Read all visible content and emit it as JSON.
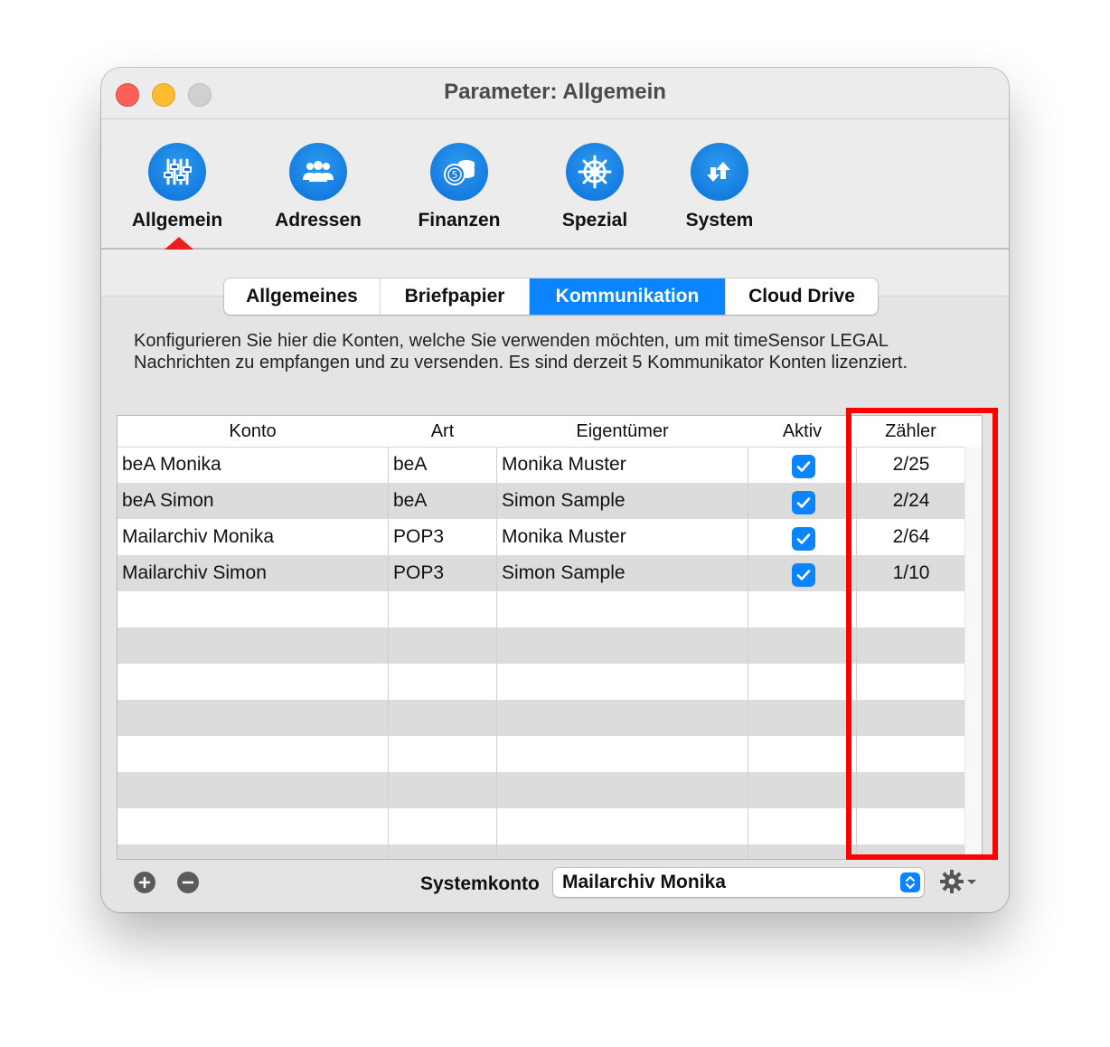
{
  "window": {
    "title": "Parameter: Allgemein"
  },
  "toolbar": {
    "items": [
      {
        "label": "Allgemein",
        "icon": "sliders-icon"
      },
      {
        "label": "Adressen",
        "icon": "people-icon"
      },
      {
        "label": "Finanzen",
        "icon": "coins-icon"
      },
      {
        "label": "Spezial",
        "icon": "helm-icon"
      },
      {
        "label": "System",
        "icon": "arrows-icon"
      }
    ],
    "selected": "Allgemein"
  },
  "tabs": [
    {
      "label": "Allgemeines"
    },
    {
      "label": "Briefpapier"
    },
    {
      "label": "Kommunikation",
      "active": true
    },
    {
      "label": "Cloud Drive"
    }
  ],
  "description": "Konfigurieren Sie hier die Konten, welche Sie verwenden möchten, um mit timeSensor LEGAL Nachrichten zu empfangen und zu versenden. Es sind derzeit 5 Kommunikator Konten lizenziert.",
  "table": {
    "columns": [
      "Konto",
      "Art",
      "Eigentümer",
      "Aktiv",
      "Zähler"
    ],
    "rows": [
      {
        "konto": "beA Monika",
        "art": "beA",
        "eigentuemer": "Monika Muster",
        "aktiv": true,
        "zaehler": "2/25"
      },
      {
        "konto": "beA Simon",
        "art": "beA",
        "eigentuemer": "Simon Sample",
        "aktiv": true,
        "zaehler": "2/24"
      },
      {
        "konto": "Mailarchiv Monika",
        "art": "POP3",
        "eigentuemer": "Monika Muster",
        "aktiv": true,
        "zaehler": "2/64"
      },
      {
        "konto": "Mailarchiv Simon",
        "art": "POP3",
        "eigentuemer": "Simon Sample",
        "aktiv": true,
        "zaehler": "1/10"
      }
    ]
  },
  "footer": {
    "system_label": "Systemkonto",
    "system_value": "Mailarchiv Monika"
  },
  "colors": {
    "accent": "#0a84ff",
    "highlight": "#ff0000"
  }
}
